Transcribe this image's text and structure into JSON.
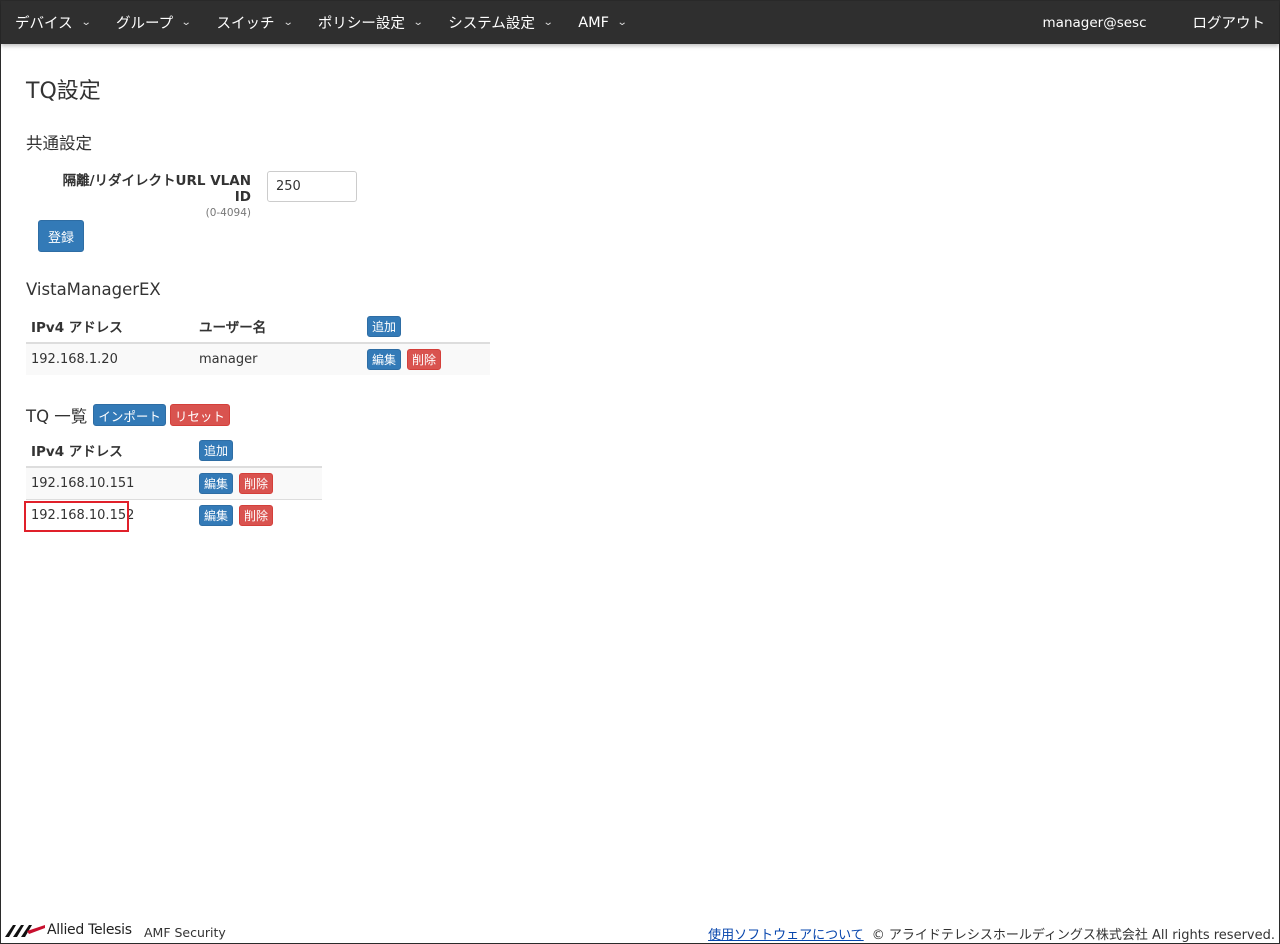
{
  "nav": {
    "items": [
      {
        "label": "デバイス"
      },
      {
        "label": "グループ"
      },
      {
        "label": "スイッチ"
      },
      {
        "label": "ポリシー設定"
      },
      {
        "label": "システム設定"
      },
      {
        "label": "AMF"
      }
    ],
    "user": "manager@sesc",
    "logout": "ログアウト"
  },
  "page": {
    "title": "TQ設定"
  },
  "common": {
    "title": "共通設定",
    "vlan_label": "隔離/リダイレクトURL VLAN ID",
    "vlan_hint": "(0-4094)",
    "vlan_value": "250",
    "register": "登録"
  },
  "vista": {
    "title": "VistaManagerEX",
    "headers": {
      "ip": "IPv4 アドレス",
      "user": "ユーザー名"
    },
    "add": "追加",
    "rows": [
      {
        "ip": "192.168.1.20",
        "user": "manager",
        "edit": "編集",
        "delete": "削除"
      }
    ]
  },
  "tq": {
    "title": "TQ 一覧",
    "import": "インポート",
    "reset": "リセット",
    "headers": {
      "ip": "IPv4 アドレス"
    },
    "add": "追加",
    "rows": [
      {
        "ip": "192.168.10.151",
        "edit": "編集",
        "delete": "削除"
      },
      {
        "ip": "192.168.10.152",
        "edit": "編集",
        "delete": "削除"
      }
    ]
  },
  "footer": {
    "logo": "Allied Telesis",
    "product": "AMF Security",
    "link": "使用ソフトウェアについて",
    "copyright": "© アライドテレシスホールディングス株式会社 All rights reserved."
  },
  "colors": {
    "primary": "#337ab7",
    "danger": "#d9534f",
    "navbar": "#2f2f2f",
    "highlight": "#e0202a"
  }
}
